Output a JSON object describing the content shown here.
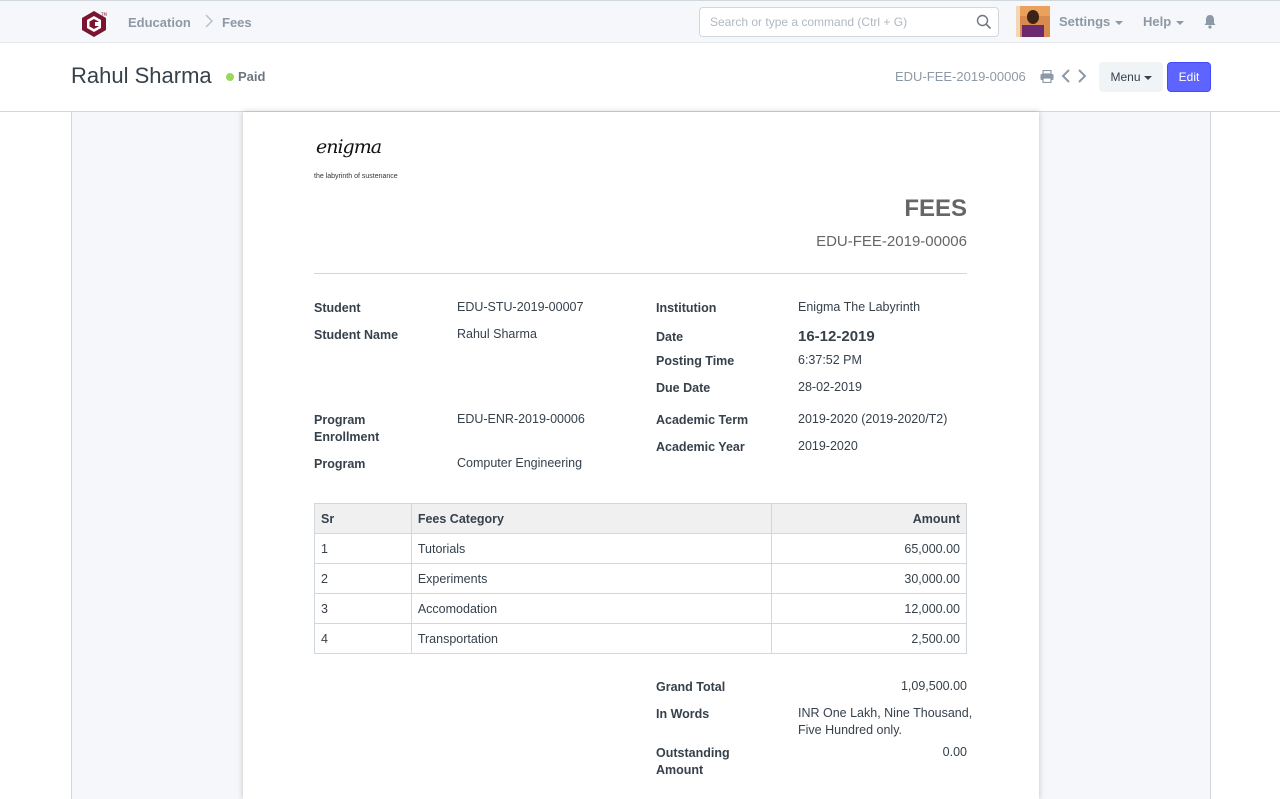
{
  "navbar": {
    "breadcrumbs": [
      "Education",
      "Fees"
    ],
    "search_placeholder": "Search or type a command (Ctrl + G)",
    "settings_label": "Settings",
    "help_label": "Help"
  },
  "page": {
    "title": "Rahul Sharma",
    "status": "Paid",
    "doc_id": "EDU-FEE-2019-00006",
    "menu_label": "Menu",
    "edit_label": "Edit"
  },
  "print": {
    "brand": "enigma",
    "tagline": "the labyrinth of sustenance",
    "heading": "FEES",
    "doc_id": "EDU-FEE-2019-00006",
    "fields": {
      "student_label": "Student",
      "student": "EDU-STU-2019-00007",
      "student_name_label": "Student Name",
      "student_name": "Rahul Sharma",
      "institution_label": "Institution",
      "institution": "Enigma The Labyrinth",
      "date_label": "Date",
      "date": "16-12-2019",
      "posting_time_label": "Posting Time",
      "posting_time": "6:37:52 PM",
      "due_date_label": "Due Date",
      "due_date": "28-02-2019",
      "program_enrollment_label_1": "Program",
      "program_enrollment_label_2": "Enrollment",
      "program_enrollment": "EDU-ENR-2019-00006",
      "program_label": "Program",
      "program": "Computer Engineering",
      "academic_term_label": "Academic Term",
      "academic_term": "2019-2020 (2019-2020/T2)",
      "academic_year_label": "Academic Year",
      "academic_year": "2019-2020"
    },
    "table": {
      "headers": [
        "Sr",
        "Fees Category",
        "Amount"
      ],
      "rows": [
        [
          "1",
          "Tutorials",
          "65,000.00"
        ],
        [
          "2",
          "Experiments",
          "30,000.00"
        ],
        [
          "3",
          "Accomodation",
          "12,000.00"
        ],
        [
          "4",
          "Transportation",
          "2,500.00"
        ]
      ]
    },
    "totals": {
      "grand_total_label": "Grand Total",
      "grand_total": "1,09,500.00",
      "in_words_label": "In Words",
      "in_words_1": "INR One Lakh, Nine Thousand,",
      "in_words_2": "Five Hundred only.",
      "outstanding_label_1": "Outstanding",
      "outstanding_label_2": "Amount",
      "outstanding": "0.00"
    }
  },
  "colors": {
    "primary": "#5e64ff",
    "status_paid": "#98d85b",
    "logo": "#7a1430"
  }
}
